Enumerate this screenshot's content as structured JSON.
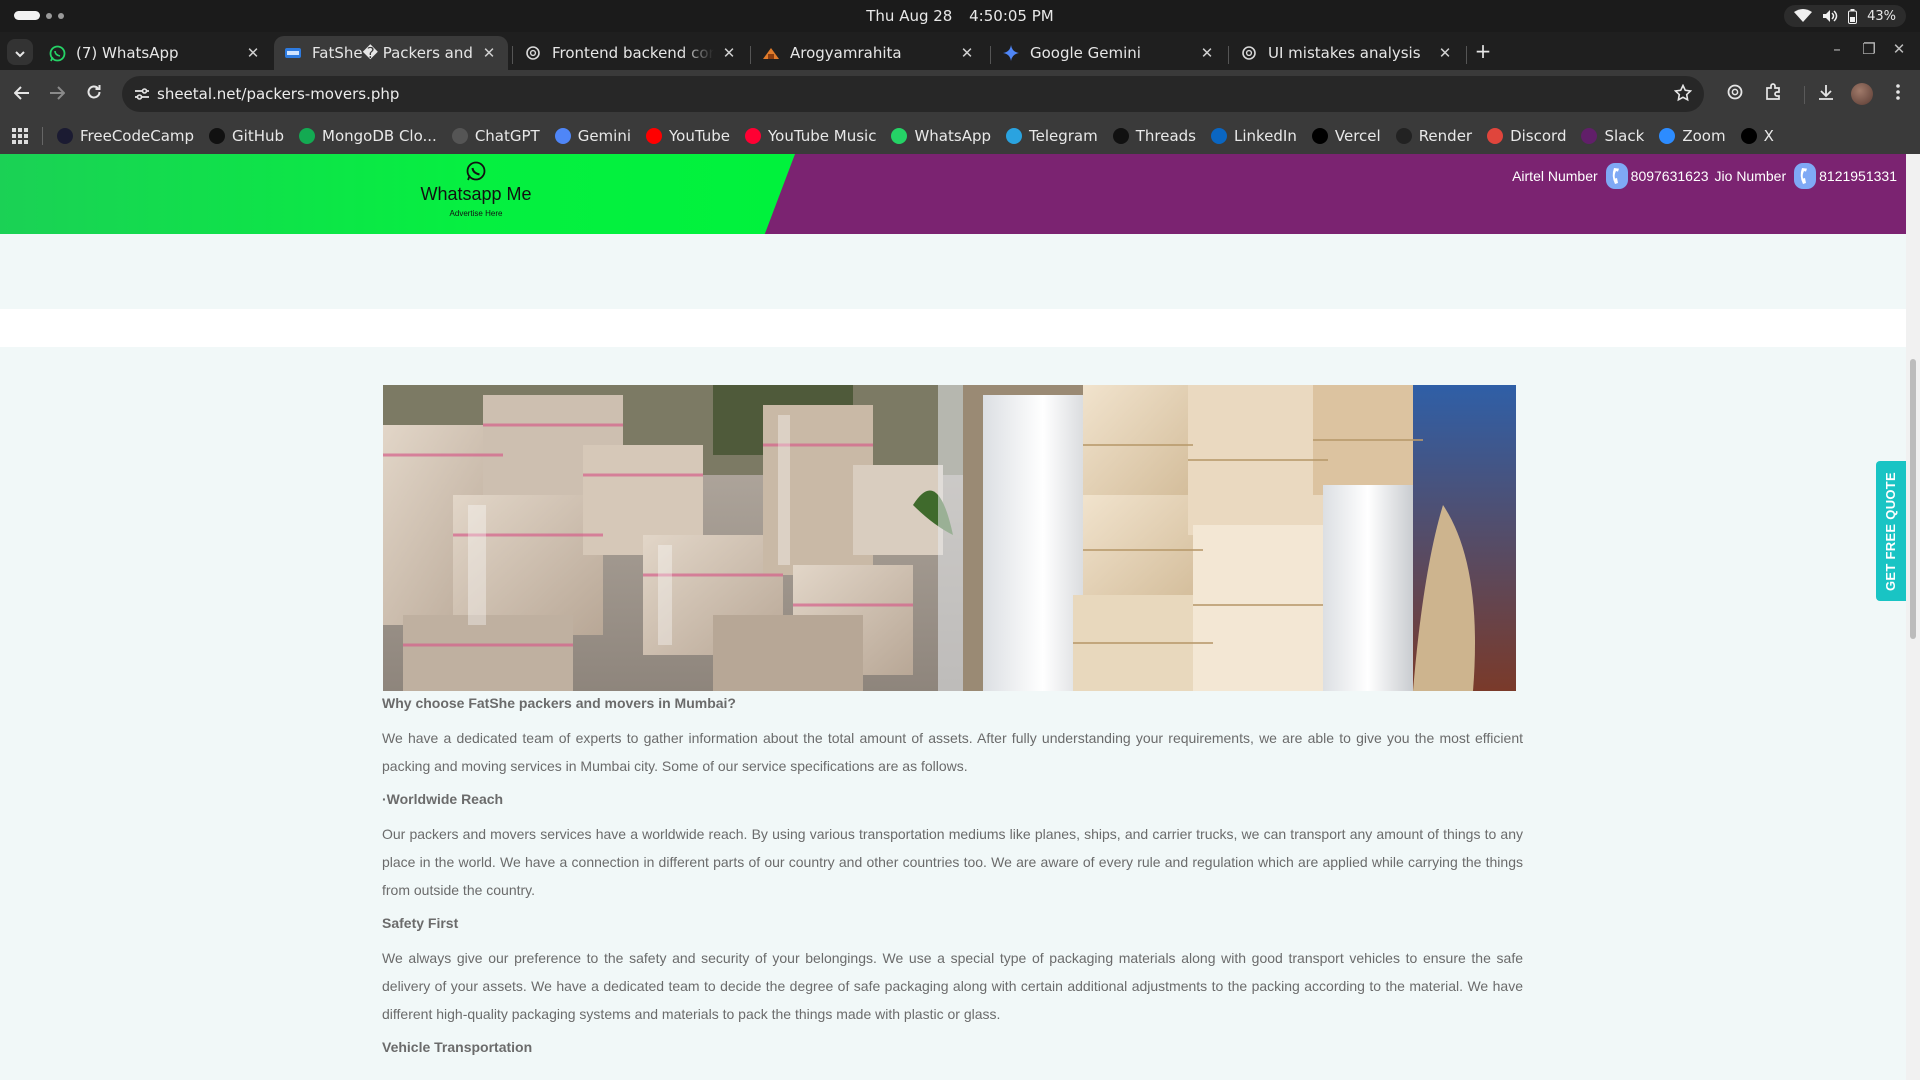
{
  "os": {
    "date": "Thu Aug 28",
    "time": "4:50:05 PM",
    "battery": "43%"
  },
  "tabs": [
    {
      "title": "(7) WhatsApp",
      "icon": "whatsapp-icon",
      "active": false
    },
    {
      "title": "FatShe� Packers and Movers",
      "icon": "site-favicon",
      "active": true
    },
    {
      "title": "Frontend backend connection",
      "icon": "chatgpt-icon",
      "active": false
    },
    {
      "title": "Arogyamrahita",
      "icon": "arogyam-icon",
      "active": false
    },
    {
      "title": "Google Gemini",
      "icon": "gemini-icon",
      "active": false
    },
    {
      "title": "UI mistakes analysis",
      "icon": "chatgpt-icon",
      "active": false
    }
  ],
  "address": {
    "host": "sheetal.net",
    "path": "/packers-movers.php"
  },
  "bookmarks": [
    {
      "label": "FreeCodeCamp",
      "icon": "freecodecamp-icon",
      "color": "#1b1b32"
    },
    {
      "label": "GitHub",
      "icon": "github-icon",
      "color": "#111111"
    },
    {
      "label": "MongoDB Clo...",
      "icon": "mongodb-icon",
      "color": "#13aa52"
    },
    {
      "label": "ChatGPT",
      "icon": "chatgpt-icon",
      "color": "#555555"
    },
    {
      "label": "Gemini",
      "icon": "gemini-icon",
      "color": "#4f86f7"
    },
    {
      "label": "YouTube",
      "icon": "youtube-icon",
      "color": "#ff0000"
    },
    {
      "label": "YouTube Music",
      "icon": "youtube-music-icon",
      "color": "#ff0033"
    },
    {
      "label": "WhatsApp",
      "icon": "whatsapp-icon",
      "color": "#25d366"
    },
    {
      "label": "Telegram",
      "icon": "telegram-icon",
      "color": "#2aa3e0"
    },
    {
      "label": "Threads",
      "icon": "threads-icon",
      "color": "#111111"
    },
    {
      "label": "LinkedIn",
      "icon": "linkedin-icon",
      "color": "#0a66c2"
    },
    {
      "label": "Vercel",
      "icon": "vercel-icon",
      "color": "#000000"
    },
    {
      "label": "Render",
      "icon": "render-icon",
      "color": "#222222"
    },
    {
      "label": "Discord",
      "icon": "discord-icon",
      "color": "#e0453c"
    },
    {
      "label": "Slack",
      "icon": "slack-icon",
      "color": "#611f69"
    },
    {
      "label": "Zoom",
      "icon": "zoom-icon",
      "color": "#2d8cff"
    },
    {
      "label": "X",
      "icon": "x-icon",
      "color": "#000000"
    }
  ],
  "banner": {
    "whatsapp_title": "Whatsapp Me",
    "whatsapp_sub": "Advertise Here",
    "airtel_label": "Airtel Number",
    "airtel_number": "8097631623",
    "jio_label": "Jio Number",
    "jio_number": "8121951331"
  },
  "quote_tab": "GET FREE QUOTE",
  "article": {
    "heading": "Why choose FatShe packers and movers in Mumbai?",
    "intro": "We have a dedicated team of experts to gather information about the total amount of assets. After fully understanding your requirements, we are able to give you the most efficient packing and moving services in Mumbai city. Some of our service specifications are as follows.",
    "sections": [
      {
        "title": "·Worldwide Reach",
        "body": "Our packers and movers services have a worldwide reach. By using various transportation mediums like planes, ships, and carrier trucks, we can transport any amount of things to any place in the world. We have a connection in different parts of our country and other countries too. We are aware of every rule and regulation which are applied while carrying the things from outside the country."
      },
      {
        "title": "Safety First",
        "body": "We always give our preference to the safety and security of your belongings. We use a special type of packaging materials along with good transport vehicles to ensure the safe delivery of your assets. We have a dedicated team to decide the degree of safe packaging along with certain additional adjustments to the packing according to the material. We have different high-quality packaging systems and materials to pack the things made with plastic or glass."
      }
    ],
    "next_heading": "Vehicle Transportation"
  }
}
